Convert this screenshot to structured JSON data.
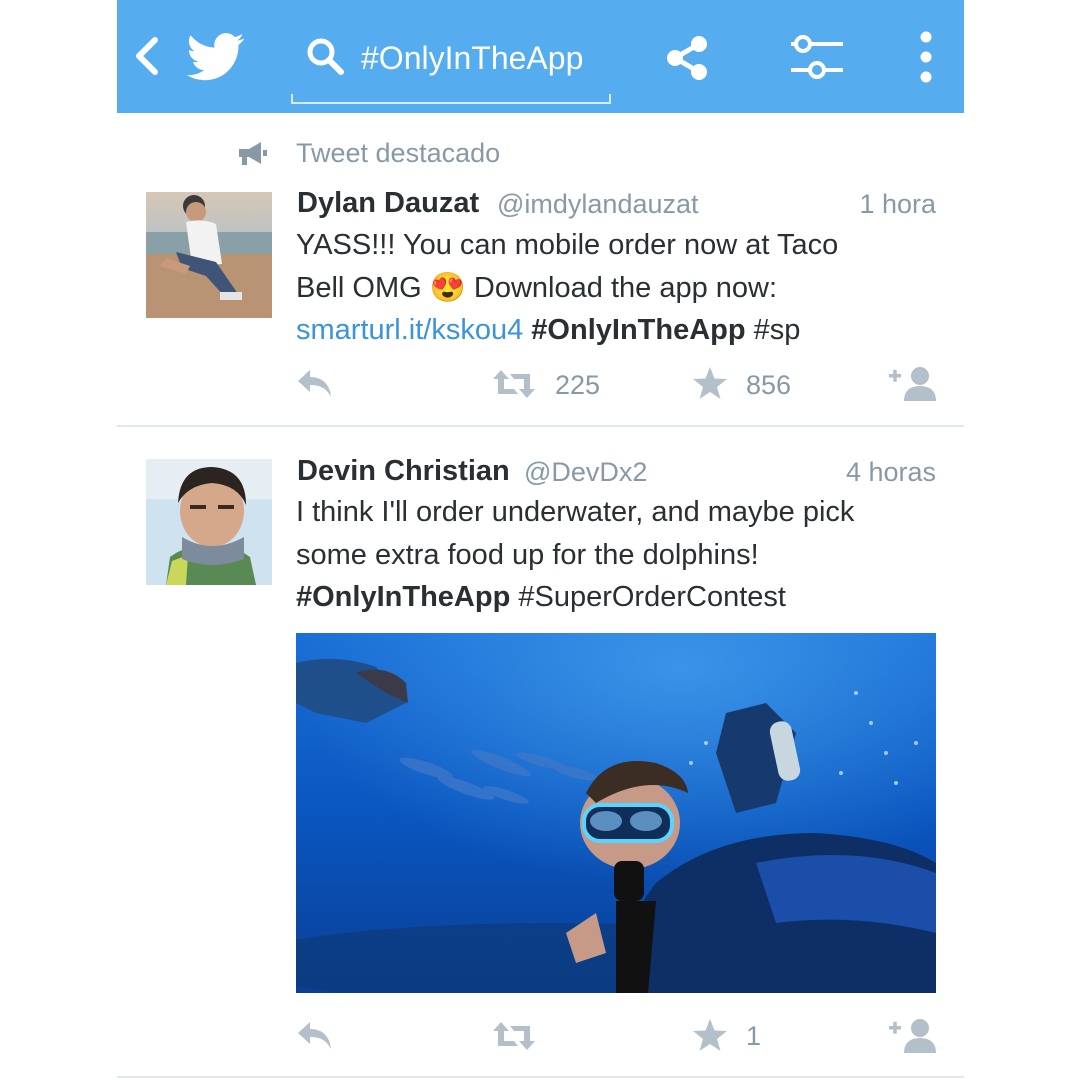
{
  "app": {
    "accent": "#55acee"
  },
  "topbar": {
    "back_icon": "chevron-left-icon",
    "logo_icon": "twitter-bird-icon",
    "search_icon": "search-icon",
    "search_query": "#OnlyInTheApp",
    "share_icon": "share-icon",
    "filter_icon": "sliders-icon",
    "more_icon": "more-vertical-icon"
  },
  "promoted": {
    "icon": "megaphone-icon",
    "label": "Tweet destacado"
  },
  "tweets": [
    {
      "name": "Dylan Dauzat",
      "handle": "@imdylandauzat",
      "time": "1 hora",
      "text_plain_1": "YASS!!! You can mobile order now at Taco",
      "text_plain_2": "Bell OMG",
      "emoji": "😍",
      "text_plain_3": " Download the app now:",
      "link": "smarturl.it/kskou4",
      "hashtag_bold": "#OnlyInTheApp",
      "hashtag_extra": "#sp",
      "retweets": "225",
      "favorites": "856"
    },
    {
      "name": "Devin Christian",
      "handle": "@DevDx2",
      "time": "4 horas",
      "text_line_1": "I think I'll order underwater, and maybe pick",
      "text_line_2": "some extra food up for the dolphins!",
      "hashtag_bold": "#OnlyInTheApp",
      "hashtag_extra": "#SuperOrderContest",
      "retweets": "",
      "favorites": "1"
    }
  ]
}
